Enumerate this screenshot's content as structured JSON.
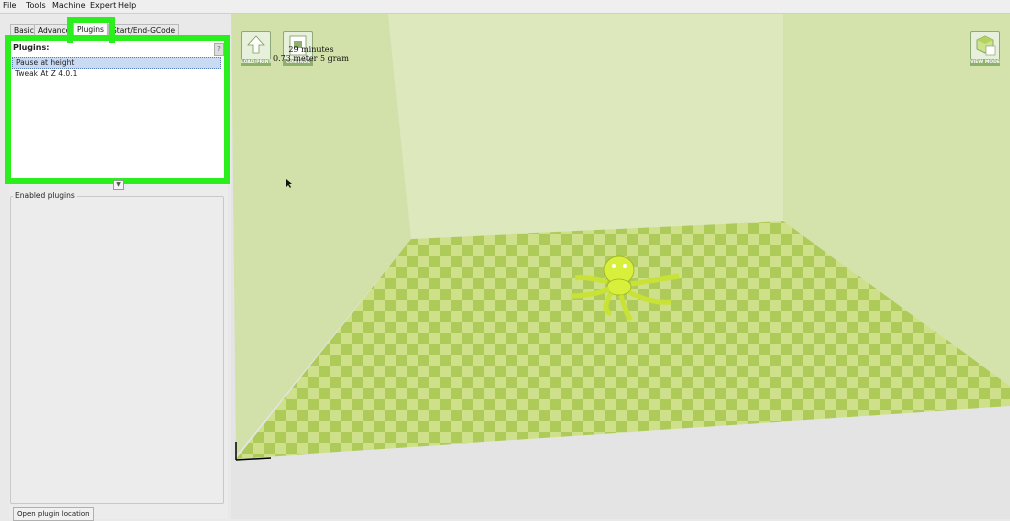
{
  "menu": [
    "File",
    "Tools",
    "Machine",
    "Expert",
    "Help"
  ],
  "tabs": [
    "Basic",
    "Advanced",
    "Plugins",
    "Start/End-GCode"
  ],
  "active_tab": "Plugins",
  "plugins_panel": {
    "label": "Plugins:",
    "items": [
      "Pause at height",
      "Tweak At Z 4.0.1"
    ],
    "selected_index": 0
  },
  "enabled_plugins_label": "Enabled plugins",
  "open_plugin_location_label": "Open plugin location",
  "viewport": {
    "toolbar": {
      "load_label": "LOAD/PRINT",
      "control_label": "CONTROL",
      "view_mode_label": "VIEW MODE"
    },
    "print_time": "29 minutes",
    "material": "0.73 meter 5 gram"
  },
  "colors": {
    "highlight": "#2bee1d",
    "model": "#d8f03c",
    "floor_light": "#cfe08a",
    "floor_dark": "#aecb5a",
    "wall": "#dde8bd",
    "selection": "#c9daf3"
  }
}
